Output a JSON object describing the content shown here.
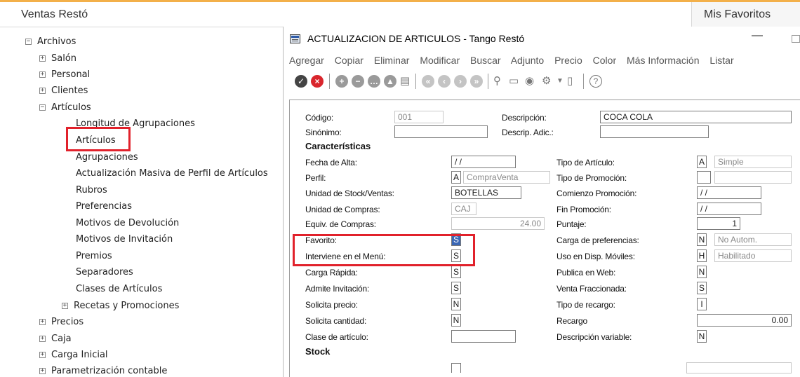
{
  "app": {
    "title": "Ventas Restó",
    "favorites_title": "Mis Favoritos"
  },
  "tree": [
    {
      "label": "Archivos",
      "box": "−"
    },
    {
      "label": "Salón",
      "box": "+"
    },
    {
      "label": "Personal",
      "box": "+"
    },
    {
      "label": "Clientes",
      "box": "+"
    },
    {
      "label": "Artículos",
      "box": "−"
    },
    {
      "label": "Longitud de Agrupaciones"
    },
    {
      "label": "Artículos"
    },
    {
      "label": "Agrupaciones"
    },
    {
      "label": "Actualización Masiva de Perfil de Artículos"
    },
    {
      "label": "Rubros"
    },
    {
      "label": "Preferencias"
    },
    {
      "label": "Motivos de Devolución"
    },
    {
      "label": "Motivos de Invitación"
    },
    {
      "label": "Premios"
    },
    {
      "label": "Separadores"
    },
    {
      "label": "Clases de Artículos"
    },
    {
      "label": "Recetas y Promociones",
      "box": "+"
    },
    {
      "label": "Precios",
      "box": "+"
    },
    {
      "label": "Caja",
      "box": "+"
    },
    {
      "label": "Carga Inicial",
      "box": "+"
    },
    {
      "label": "Parametrización contable",
      "box": "+"
    }
  ],
  "window": {
    "title": "ACTUALIZACION DE ARTICULOS - Tango Restó",
    "minimize": "—",
    "menu": [
      "Agregar",
      "Copiar",
      "Eliminar",
      "Modificar",
      "Buscar",
      "Adjunto",
      "Precio",
      "Color",
      "Más Información",
      "Listar"
    ]
  },
  "toolbar_icons": [
    "check-icon",
    "cancel-icon",
    "add-icon",
    "remove-icon",
    "more-icon",
    "up-icon",
    "document-icon",
    "first-icon",
    "prev-icon",
    "next-icon",
    "last-icon",
    "binoculars-icon",
    "monitor-icon",
    "circle-i-icon",
    "gear-icon",
    "dropdown-icon",
    "attach-icon",
    "help-icon"
  ],
  "form": {
    "codigo": {
      "label": "Código:",
      "value": "001"
    },
    "descripcion": {
      "label": "Descripción:",
      "value": "COCA COLA"
    },
    "sinonimo": {
      "label": "Sinónimo:",
      "value": ""
    },
    "descrip_adic": {
      "label": "Descrip. Adic.:",
      "value": ""
    },
    "caracteristicas": "Características",
    "fecha_alta": {
      "label": "Fecha de Alta:",
      "value": "/ /"
    },
    "perfil": {
      "label": "Perfil:",
      "code": "A",
      "value": "CompraVenta"
    },
    "unidad_stock": {
      "label": "Unidad de Stock/Ventas:",
      "value": "BOTELLAS"
    },
    "unidad_compras": {
      "label": "Unidad de Compras:",
      "value": "CAJ"
    },
    "equiv_compras": {
      "label": "Equiv. de Compras:",
      "value": "24.00"
    },
    "favorito": {
      "label": "Favorito:",
      "value": "S"
    },
    "interviene_menu": {
      "label": "Interviene en el Menú:",
      "value": "S"
    },
    "carga_rapida": {
      "label": "Carga Rápida:",
      "value": "S"
    },
    "admite_invitacion": {
      "label": "Admite Invitación:",
      "value": "S"
    },
    "solicita_precio": {
      "label": "Solicita precio:",
      "value": "N"
    },
    "solicita_cantidad": {
      "label": "Solicita cantidad:",
      "value": "N"
    },
    "clase_articulo": {
      "label": "Clase de artículo:",
      "value": ""
    },
    "stock": "Stock",
    "tipo_articulo": {
      "label": "Tipo de Artículo:",
      "code": "A",
      "value": "Simple"
    },
    "tipo_promocion": {
      "label": "Tipo de Promoción:",
      "code": "",
      "value": ""
    },
    "comienzo_promocion": {
      "label": "Comienzo Promoción:",
      "value": "/ /"
    },
    "fin_promocion": {
      "label": "Fin Promoción:",
      "value": "/ /"
    },
    "puntaje": {
      "label": "Puntaje:",
      "value": "1"
    },
    "carga_preferencias": {
      "label": "Carga de preferencias:",
      "code": "N",
      "value": "No Autom."
    },
    "uso_moviles": {
      "label": "Uso en Disp. Móviles:",
      "code": "H",
      "value": "Habilitado"
    },
    "publica_web": {
      "label": "Publica en Web:",
      "value": "N"
    },
    "venta_fraccionada": {
      "label": "Venta Fraccionada:",
      "value": "S"
    },
    "tipo_recargo": {
      "label": "Tipo de recargo:",
      "value": "I"
    },
    "recargo": {
      "label": "Recargo",
      "value": "0.00"
    },
    "descripcion_variable": {
      "label": "Descripción variable:",
      "value": "N"
    }
  },
  "colors": {
    "highlight": "#e1212b",
    "accent_top": "#f3b04a"
  }
}
